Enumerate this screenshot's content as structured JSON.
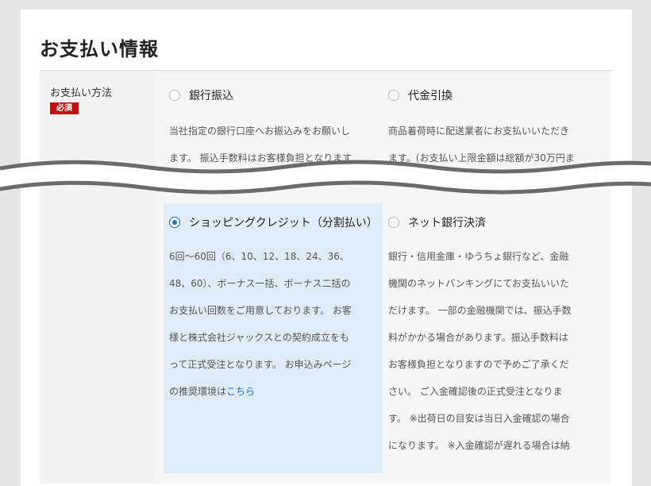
{
  "section": {
    "title": "お支払い情報"
  },
  "field": {
    "label": "お支払い方法",
    "required_badge": "必須"
  },
  "options": [
    {
      "label": "銀行振込",
      "selected": false,
      "desc_lines": [
        "当社指定の銀行口座へお振込みをお願いし",
        "ます。 振込手数料はお客様負担となります"
      ]
    },
    {
      "label": "代金引換",
      "selected": false,
      "desc_lines": [
        "商品着荷時に配送業者にお支払いいただき",
        "ます。(お支払い上限金額は総額が30万円ま"
      ]
    },
    {
      "label": "ショッピングクレジット（分割払い）",
      "selected": true,
      "desc_lines": [
        "6回〜60回（6、10、12、18、24、36、",
        "48、60）、ボーナス一括、ボーナス二括の",
        "お支払い回数をご用意しております。 お客",
        "様と株式会社ジャックスとの契約成立をも",
        "って正式受注となります。 お申込みページ",
        "の推奨環境は"
      ],
      "link_text": "こちら"
    },
    {
      "label": "ネット銀行決済",
      "selected": false,
      "desc_lines": [
        "銀行・信用金庫・ゆうちょ銀行など、金融",
        "機関のネットバンキングにてお支払いいた",
        "だけます。 一部の金融機関では、振込手数",
        "料がかかる場合があります。振込手数料は",
        "お客様負担となりますので予めご了承くだ",
        "さい。 ご入金確認後の正式受注となりま",
        "す。 ※出荷日の目安は当日入金確認の場合",
        "になります。 ※入金確認が遅れる場合は納"
      ]
    }
  ]
}
